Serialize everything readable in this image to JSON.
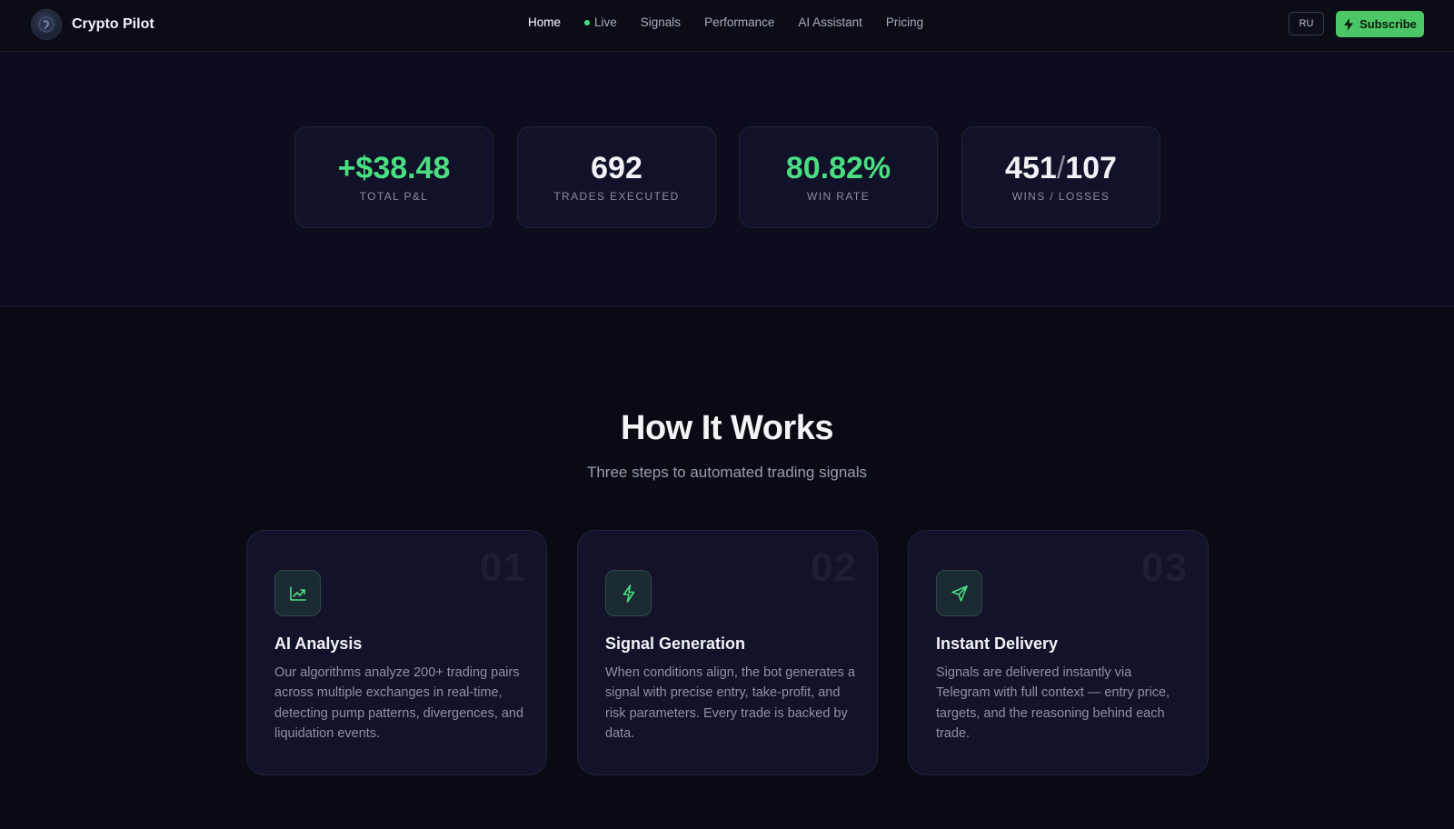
{
  "nav": {
    "brand": "Crypto Pilot",
    "links": [
      {
        "label": "Home"
      },
      {
        "label": "Live"
      },
      {
        "label": "Signals"
      },
      {
        "label": "Performance"
      },
      {
        "label": "AI Assistant"
      },
      {
        "label": "Pricing"
      }
    ],
    "lang_label": "RU",
    "subscribe_label": "Subscribe"
  },
  "stats": [
    {
      "value": "+$38.48",
      "label": "TOTAL P&L",
      "color": "#4ade80"
    },
    {
      "value": "692",
      "label": "TRADES EXECUTED"
    },
    {
      "value": "80.82%",
      "label": "WIN RATE",
      "color": "#4ade80"
    },
    {
      "wins": "451",
      "sep": "/",
      "losses": "107",
      "label": "WINS / LOSSES"
    }
  ],
  "how": {
    "title": "How It Works",
    "subtitle": "Three steps to automated trading signals",
    "steps": [
      {
        "num": "01",
        "icon": "chart-line-icon",
        "title": "AI Analysis",
        "desc": "Our algorithms analyze 200+ trading pairs across multiple exchanges in real-time, detecting pump patterns, divergences, and liquidation events."
      },
      {
        "num": "02",
        "icon": "lightning-icon",
        "title": "Signal Generation",
        "desc": "When conditions align, the bot generates a signal with precise entry, take-profit, and risk parameters. Every trade is backed by data."
      },
      {
        "num": "03",
        "icon": "send-icon",
        "title": "Instant Delivery",
        "desc": "Signals are delivered instantly via Telegram with full context — entry price, targets, and the reasoning behind each trade."
      }
    ]
  },
  "colors": {
    "accent": "#4ade80",
    "button": "#4cc766",
    "background": "#0a0a14"
  }
}
